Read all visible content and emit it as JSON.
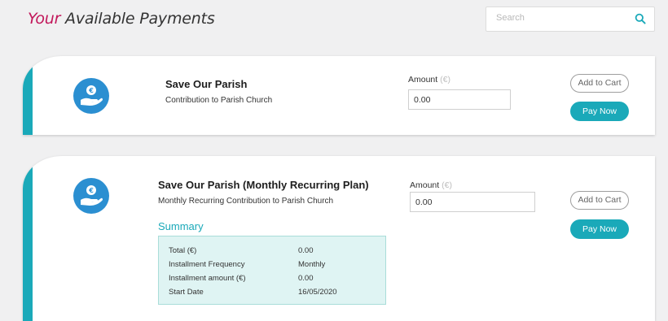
{
  "header": {
    "title_accent": "Your",
    "title_rest": " Available Payments",
    "search_placeholder": "Search"
  },
  "colors": {
    "accent": "#c2185b",
    "teal": "#1aa9b9",
    "logo_blue": "#2b8fd1",
    "summary_bg": "#dff4f3"
  },
  "payments": [
    {
      "icon": "donation-hand-icon",
      "title": "Save Our Parish",
      "subtitle": "Contribution to Parish Church",
      "amount_label": "Amount",
      "amount_unit": "(€)",
      "amount_value": "0.00",
      "add_to_cart_label": "Add to Cart",
      "pay_now_label": "Pay Now"
    },
    {
      "icon": "donation-hand-icon",
      "title": "Save Our Parish (Monthly Recurring Plan)",
      "subtitle": "Monthly Recurring Contribution to Parish Church",
      "amount_label": "Amount",
      "amount_unit": "(€)",
      "amount_value": "0.00",
      "add_to_cart_label": "Add to Cart",
      "pay_now_label": "Pay Now",
      "summary": {
        "title": "Summary",
        "rows": [
          {
            "label": "Total (€)",
            "value": "0.00"
          },
          {
            "label": "Installment Frequency",
            "value": "Monthly"
          },
          {
            "label": "Installment amount (€)",
            "value": "0.00"
          },
          {
            "label": "Start Date",
            "value": "16/05/2020"
          }
        ]
      }
    }
  ]
}
